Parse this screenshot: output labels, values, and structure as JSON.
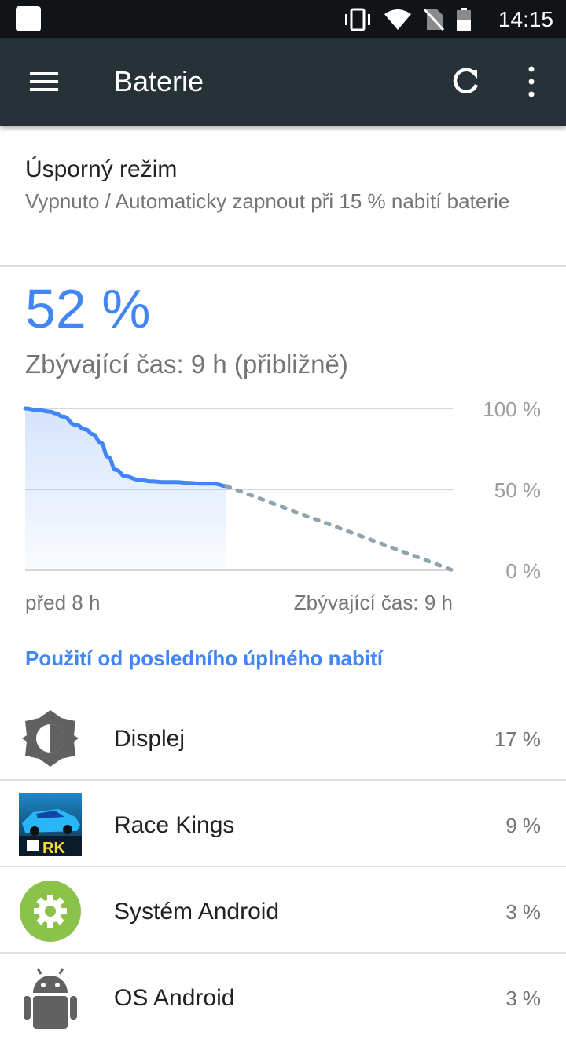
{
  "status_bar": {
    "time": "14:15",
    "icons": [
      "notification-icon",
      "vibrate-icon",
      "wifi-icon",
      "no-sim-icon",
      "battery-icon"
    ]
  },
  "toolbar": {
    "title": "Baterie",
    "menu_icon": "hamburger-menu-icon",
    "refresh_icon": "refresh-icon",
    "more_icon": "more-vert-icon"
  },
  "battery_saver": {
    "title": "Úsporný režim",
    "summary": "Vypnuto / Automaticky zapnout při 15 % nabití baterie"
  },
  "battery": {
    "level": "52 %",
    "remaining": "Zbývající čas: 9 h (přibližně)"
  },
  "chart_data": {
    "type": "area",
    "title": "",
    "x_label_start": "před 8 h",
    "x_label_end": "Zbývající čas: 9 h",
    "y_ticks": [
      "100 %",
      "50 %",
      "0 %"
    ],
    "ylim": [
      0,
      100
    ],
    "xlim": [
      -8,
      9
    ],
    "history": {
      "x": [
        -8,
        -7.5,
        -7,
        -6.8,
        -6.5,
        -6,
        -5.6,
        -5.3,
        -5,
        -4.7,
        -4.4,
        -4,
        -3.5,
        -3,
        -2.5,
        -2,
        -1.5,
        -1,
        -0.5,
        0
      ],
      "y": [
        100,
        99,
        98,
        97,
        95,
        90,
        87,
        84,
        79,
        70,
        62,
        58,
        56,
        55,
        54.5,
        54.5,
        54,
        53.5,
        53.5,
        52
      ]
    },
    "projection": {
      "x": [
        0,
        9
      ],
      "y": [
        52,
        0
      ]
    },
    "colors": {
      "line": "#4285f4",
      "fill": "#4285f4",
      "projection": "#90a4ae",
      "grid": "#d6d6d6"
    }
  },
  "usage": {
    "header": "Použití od posledního úplného nabití",
    "items": [
      {
        "label": "Displej",
        "value": "17 %",
        "icon": "brightness-icon"
      },
      {
        "label": "Race Kings",
        "value": "9 %",
        "icon": "race-kings-app-icon",
        "icon_text": "RK"
      },
      {
        "label": "Systém Android",
        "value": "3 %",
        "icon": "android-settings-icon"
      },
      {
        "label": "OS Android",
        "value": "3 %",
        "icon": "android-robot-icon"
      }
    ]
  },
  "colors": {
    "accent": "#4285f4",
    "toolbar": "#263238",
    "status_bar": "#111416",
    "settings_green": "#8bc34a"
  }
}
